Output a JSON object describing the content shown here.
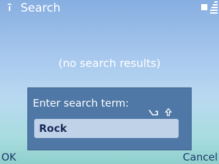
{
  "status_bar": {
    "title": "Search",
    "signal_icon": "signal-antenna-icon",
    "indicator_icon": "active-app-indicator-icon",
    "battery_icon": "battery-icon"
  },
  "main": {
    "empty_message": "(no search results)"
  },
  "dialog": {
    "prompt": "Enter search term:",
    "input_mode_icons": [
      "predictive-text-icon",
      "shift-icon"
    ],
    "search_value": "Rock"
  },
  "softkeys": {
    "left": "OK",
    "right": "Cancel"
  }
}
